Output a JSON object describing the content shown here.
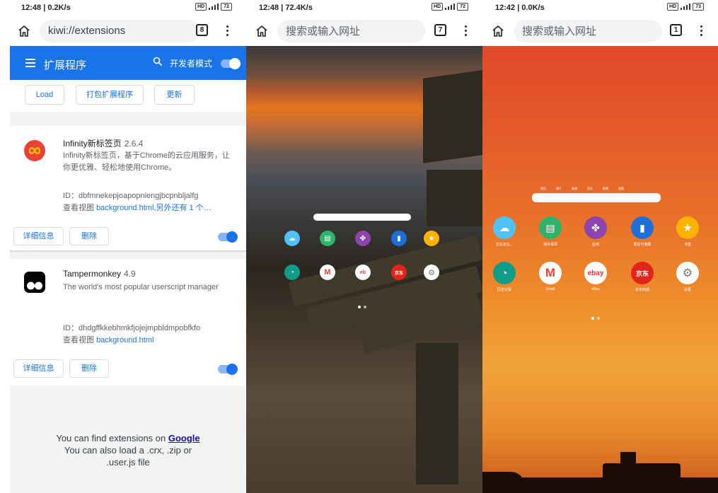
{
  "panel1": {
    "status": {
      "time": "12:48 | 0.2K/s",
      "hd": "HD",
      "net": "5G",
      "battery": "72"
    },
    "url": "kiwi://extensions",
    "tab_count": "8",
    "appbar": {
      "title": "扩展程序",
      "dev_mode": "开发者模式"
    },
    "buttons": {
      "load": "Load",
      "pack": "打包扩展程序",
      "update": "更新"
    },
    "extensions": [
      {
        "name": "Infinity新标签页",
        "version": "2.6.4",
        "description": "Infinity新标签页，基于Chrome的云应用服务，让你更优雅、轻松地使用Chrome。",
        "id": "ID：dbfmnekepjoapopniengjbcpnbljalfg",
        "view_label": "查看视图",
        "view_link": "background.html,另外还有 1 个…",
        "details": "详细信息",
        "remove": "删除"
      },
      {
        "name": "Tampermonkey",
        "version": "4.9",
        "description": "The world's most popular userscript manager",
        "id": "ID：dhdgffkkebhmkfjojejmpbldmpobfkfo",
        "view_label": "查看视图",
        "view_link": "background.html",
        "details": "详细信息",
        "remove": "删除"
      }
    ],
    "footer": {
      "line1_pre": "You can find extensions on ",
      "line1_link": "Google",
      "line2": "You can also load a .crx, .zip or",
      "line3": ".user.js file"
    }
  },
  "panel2": {
    "status": {
      "time": "12:48 | 72.4K/s",
      "hd": "HD",
      "net": "5G",
      "battery": "72"
    },
    "url_placeholder": "搜索或输入网址",
    "tab_count": "7"
  },
  "panel3": {
    "status": {
      "time": "12:42 | 0.0K/s",
      "hd": "HD",
      "net": "5G",
      "battery": "73"
    },
    "url_placeholder": "搜索或输入网址",
    "tab_count": "1",
    "mini_tabs": [
      "网页",
      "图片",
      "新闻",
      "音乐",
      "视频",
      "地图"
    ],
    "apps": [
      {
        "label": "正在定位...",
        "color": "#4fc3f7",
        "icon": "weather-icon"
      },
      {
        "label": "待办事项",
        "color": "#2db46a",
        "icon": "todo-icon"
      },
      {
        "label": "应用",
        "color": "#8e44ad",
        "icon": "apps-icon"
      },
      {
        "label": "笔记与收藏",
        "color": "#1e6fd9",
        "icon": "notes-icon"
      },
      {
        "label": "书签",
        "color": "#ffb300",
        "icon": "bookmark-star-icon"
      },
      {
        "label": "历史记录",
        "color": "#0f9d8a",
        "icon": "history-icon"
      },
      {
        "label": "Gmail",
        "color": "#ffffff",
        "icon": "gmail-icon"
      },
      {
        "label": "eBay",
        "color": "#ffffff",
        "icon": "ebay-icon"
      },
      {
        "label": "京东商城",
        "color": "#e1251b",
        "icon": "jd-icon"
      },
      {
        "label": "设置",
        "color": "#ffffff",
        "icon": "settings-icon"
      }
    ]
  }
}
